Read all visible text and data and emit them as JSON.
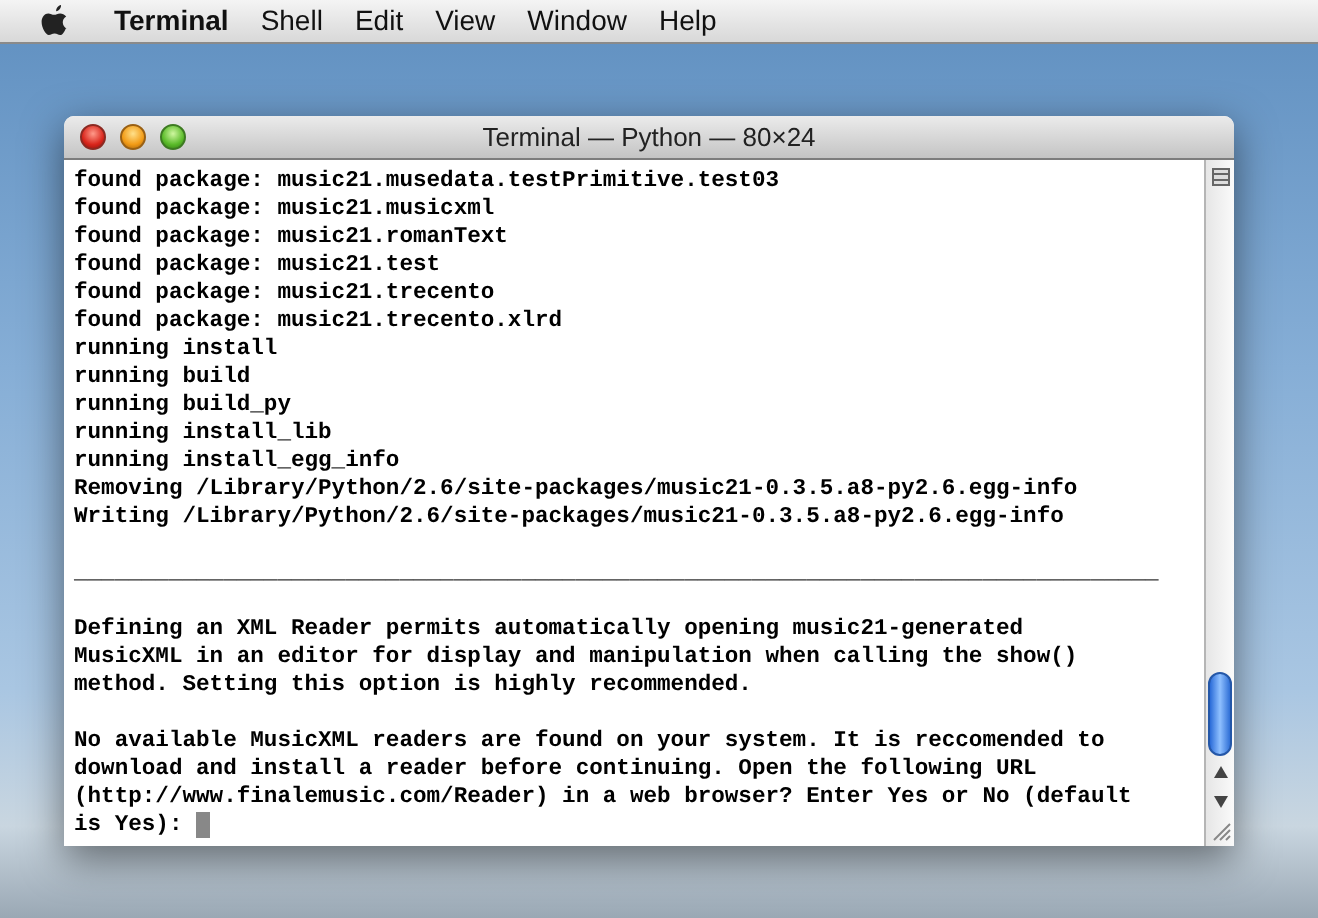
{
  "menu_bar": {
    "app": "Terminal",
    "items": [
      "Shell",
      "Edit",
      "View",
      "Window",
      "Help"
    ]
  },
  "window": {
    "title": "Terminal — Python — 80×24"
  },
  "terminal": {
    "blocks": [
      [
        "found package: music21.musedata.testPrimitive.test03",
        "found package: music21.musicxml",
        "found package: music21.romanText",
        "found package: music21.test",
        "found package: music21.trecento",
        "found package: music21.trecento.xlrd",
        "running install",
        "running build",
        "running build_py",
        "running install_lib",
        "running install_egg_info",
        "Removing /Library/Python/2.6/site-packages/music21-0.3.5.a8-py2.6.egg-info",
        "Writing /Library/Python/2.6/site-packages/music21-0.3.5.a8-py2.6.egg-info"
      ],
      [
        "________________________________________________________________________________"
      ],
      [
        "Defining an XML Reader permits automatically opening music21-generated",
        "MusicXML in an editor for display and manipulation when calling the show()",
        "method. Setting this option is highly recommended."
      ],
      [
        "No available MusicXML readers are found on your system. It is reccomended to",
        "download and install a reader before continuing. Open the following URL",
        "(http://www.finalemusic.com/Reader) in a web browser? Enter Yes or No (default",
        "is Yes): "
      ]
    ],
    "cursor_visible": true
  }
}
